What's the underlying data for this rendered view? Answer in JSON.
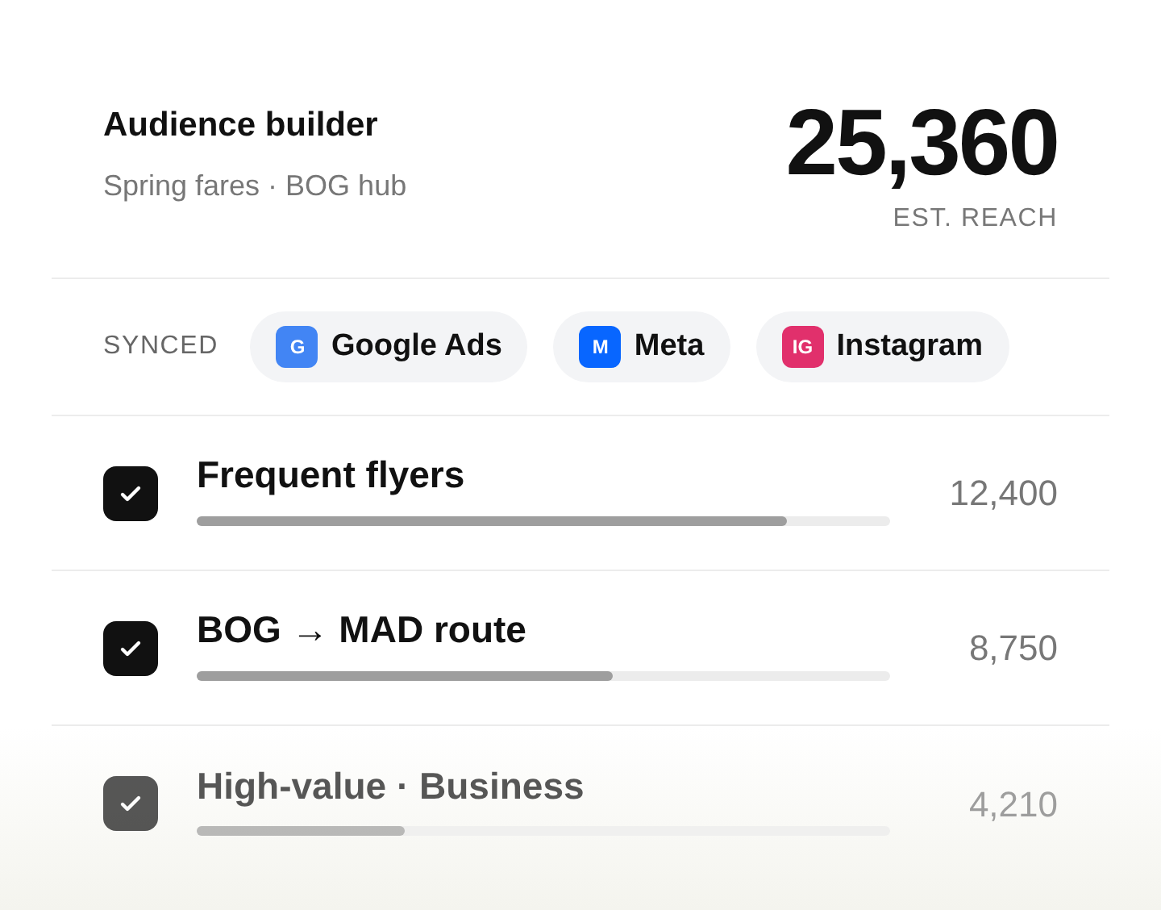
{
  "header": {
    "title": "Audience builder",
    "subtitle": "Spring fares · BOG hub",
    "reach": "25,360",
    "reach_label": "EST. REACH"
  },
  "synced": {
    "label": "SYNCED",
    "channels": [
      {
        "badge": "G",
        "name": "Google Ads",
        "color": "#4285f4"
      },
      {
        "badge": "M",
        "name": "Meta",
        "color": "#0866ff"
      },
      {
        "badge": "IG",
        "name": "Instagram",
        "color": "#e1306c"
      }
    ]
  },
  "segments": [
    {
      "name": "Frequent flyers",
      "checked": true,
      "level": 0.85,
      "count": "12,400"
    },
    {
      "name": "BOG → MAD route",
      "checked": true,
      "level": 0.6,
      "count": "8,750"
    },
    {
      "name": "High-value · Business",
      "checked": true,
      "level": 0.3,
      "count": "4,210"
    }
  ]
}
